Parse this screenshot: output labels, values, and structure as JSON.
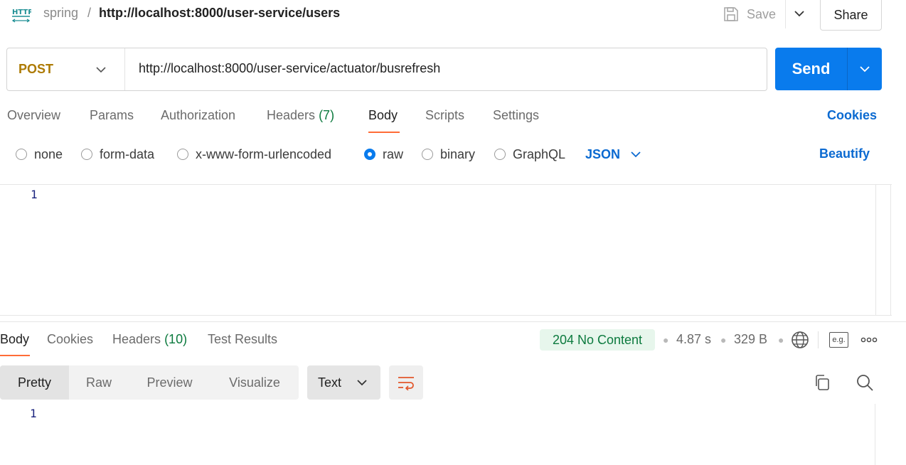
{
  "header": {
    "icon": "http-icon",
    "collection": "spring",
    "separator": "/",
    "request_name": "http://localhost:8000/user-service/users",
    "save_label": "Save",
    "share_label": "Share"
  },
  "request": {
    "method": "POST",
    "url": "http://localhost:8000/user-service/actuator/busrefresh",
    "send_label": "Send"
  },
  "request_tabs": {
    "overview": "Overview",
    "params": "Params",
    "authorization": "Authorization",
    "headers": "Headers",
    "headers_count": "(7)",
    "body": "Body",
    "scripts": "Scripts",
    "settings": "Settings",
    "cookies": "Cookies"
  },
  "body_modes": {
    "none": "none",
    "form_data": "form-data",
    "urlencoded": "x-www-form-urlencoded",
    "raw": "raw",
    "binary": "binary",
    "graphql": "GraphQL",
    "selected": "raw",
    "language": "JSON",
    "beautify": "Beautify"
  },
  "editor": {
    "line_number": "1"
  },
  "response": {
    "tabs": {
      "body": "Body",
      "cookies": "Cookies",
      "headers": "Headers",
      "headers_count": "(10)",
      "test_results": "Test Results"
    },
    "status": "204 No Content",
    "time": "4.87 s",
    "size": "329 B",
    "eg_label": "e.g.",
    "formats": {
      "pretty": "Pretty",
      "raw": "Raw",
      "preview": "Preview",
      "visualize": "Visualize"
    },
    "text_type": "Text",
    "line_number": "1"
  },
  "colors": {
    "accent_orange": "#ff6c37",
    "send_blue": "#097bed",
    "link_blue": "#0b6ad1",
    "method_post": "#ad7a03",
    "success_green": "#0c7a3e"
  }
}
